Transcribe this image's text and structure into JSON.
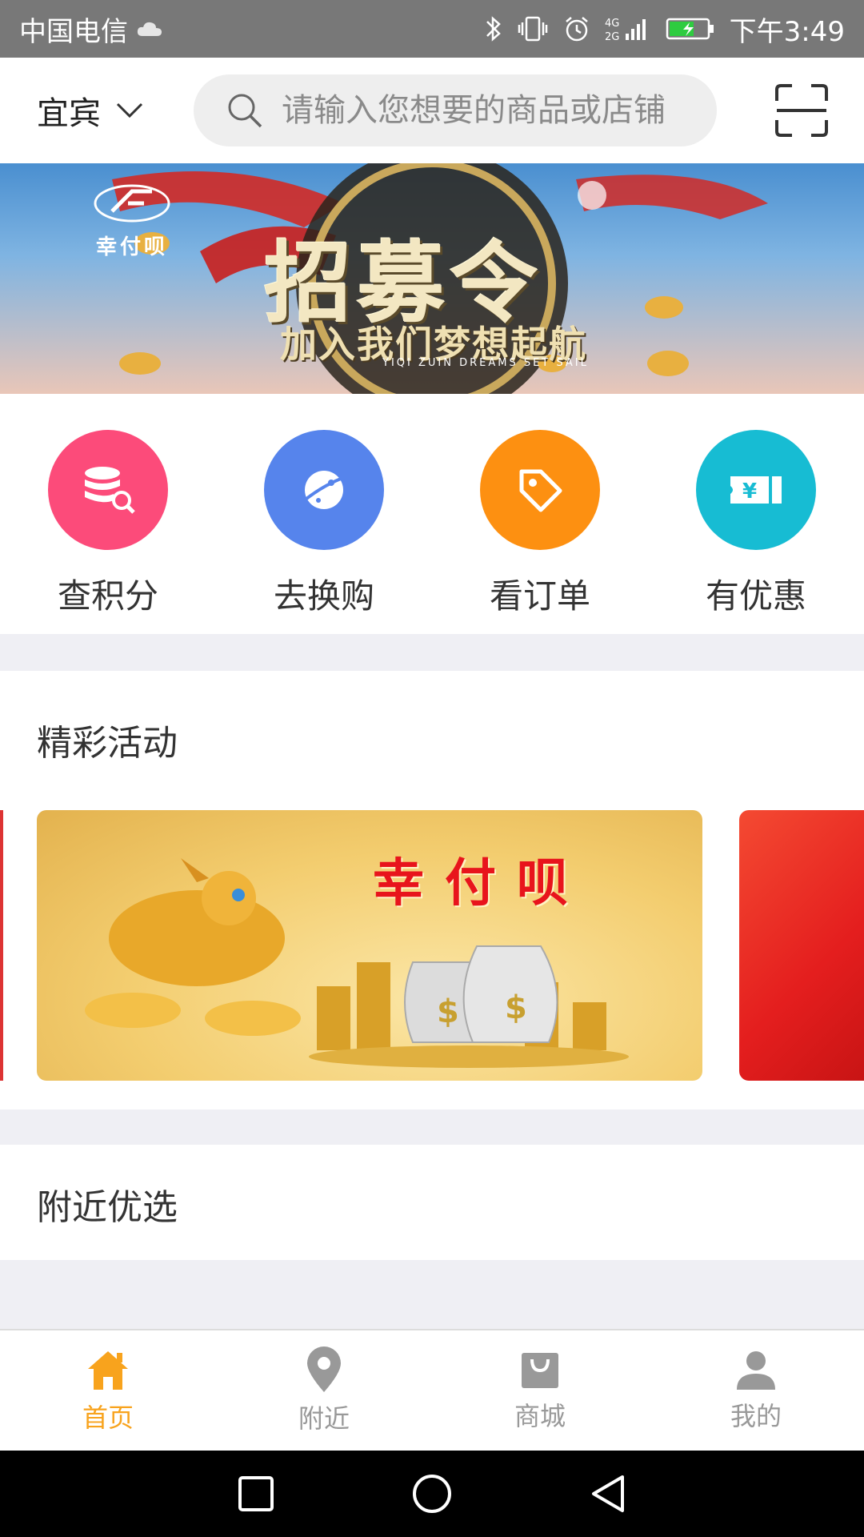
{
  "status_bar": {
    "carrier": "中国电信",
    "network": "4G 2G",
    "time": "下午3:49"
  },
  "header": {
    "city": "宜宾",
    "search_placeholder": "请输入您想要的商品或店铺"
  },
  "banner": {
    "logo_text": "幸付呗",
    "title": "招募令",
    "subtitle": "加入我们梦想起航",
    "subtitle_en": "YIQI ZUIN DREAMS SET SAIL"
  },
  "quick_menu": [
    {
      "label": "查积分",
      "icon": "points-database-icon",
      "color": "#fc4b7a"
    },
    {
      "label": "去换购",
      "icon": "planet-icon",
      "color": "#5684ec"
    },
    {
      "label": "看订单",
      "icon": "tag-icon",
      "color": "#fd9011"
    },
    {
      "label": "有优惠",
      "icon": "coupon-icon",
      "color": "#17bcd3"
    }
  ],
  "sections": {
    "activities_title": "精彩活动",
    "nearby_title": "附近优选"
  },
  "activity_banner": {
    "title": "幸付呗"
  },
  "bottom_nav": [
    {
      "label": "首页",
      "icon": "home-icon",
      "active": true
    },
    {
      "label": "附近",
      "icon": "location-pin-icon",
      "active": false
    },
    {
      "label": "商城",
      "icon": "shopping-bag-icon",
      "active": false
    },
    {
      "label": "我的",
      "icon": "user-icon",
      "active": false
    }
  ],
  "colors": {
    "accent": "#f8a31d",
    "inactive": "#999999",
    "section_gap": "#efeff4"
  }
}
